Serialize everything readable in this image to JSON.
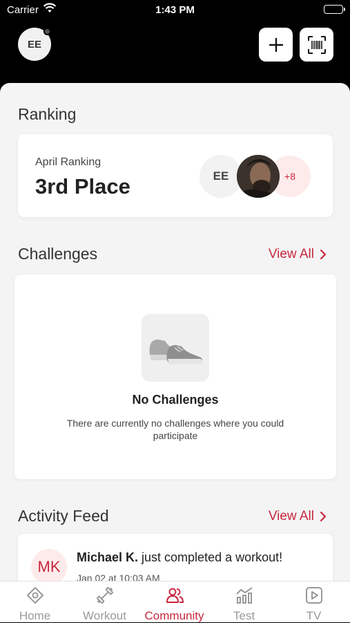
{
  "status_bar": {
    "carrier": "Carrier",
    "time": "1:43 PM"
  },
  "header": {
    "avatar_initials": "EE"
  },
  "ranking": {
    "section_title": "Ranking",
    "label": "April Ranking",
    "place": "3rd Place",
    "avatars": {
      "initials": "EE",
      "more": "+8"
    }
  },
  "challenges": {
    "section_title": "Challenges",
    "view_all": "View All",
    "empty_title": "No Challenges",
    "empty_desc": "There are currently no challenges where you could participate"
  },
  "activity_feed": {
    "section_title": "Activity Feed",
    "view_all": "View All",
    "items": [
      {
        "initials": "MK",
        "name": "Michael K.",
        "action": " just completed a workout!",
        "time": "Jan 02 at 10:03 AM"
      }
    ]
  },
  "tabbar": {
    "tabs": [
      {
        "label": "Home",
        "icon": "home-icon"
      },
      {
        "label": "Workout",
        "icon": "dumbbell-icon"
      },
      {
        "label": "Community",
        "icon": "community-icon"
      },
      {
        "label": "Test",
        "icon": "test-chart-icon"
      },
      {
        "label": "TV",
        "icon": "tv-play-icon"
      }
    ],
    "active": "Community"
  },
  "colors": {
    "accent": "#c8273d",
    "background": "#f4f4f4",
    "header": "#000000"
  }
}
